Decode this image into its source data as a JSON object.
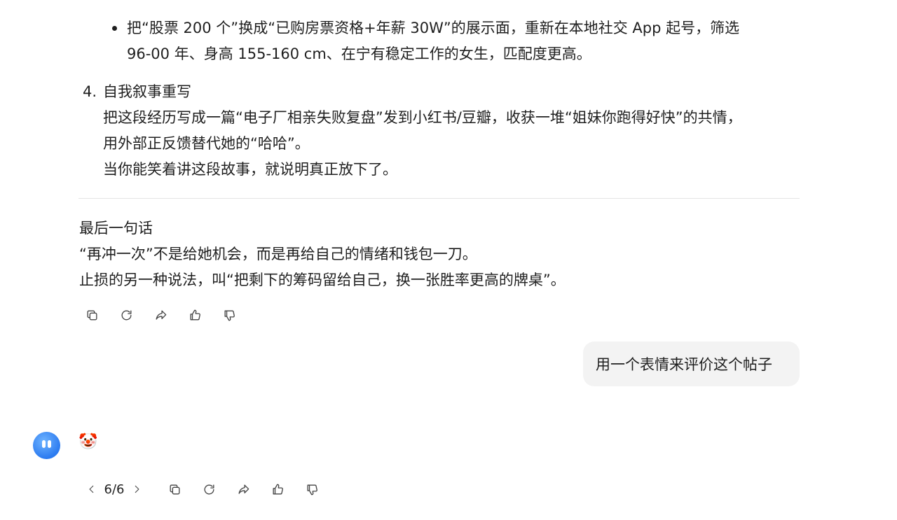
{
  "conversation": {
    "bullet_line1": "把“股票 200 个”换成“已购房票资格+年薪 30W”的展示面，重新在本地社交 App 起号，筛选",
    "bullet_line2": "96-00 年、身高 155-160 cm、在宁有稳定工作的女生，匹配度更高。",
    "item4_number": "4.",
    "item4_title": "自我叙事重写",
    "item4_line1": "把这段经历写成一篇“电子厂相亲失败复盘”发到小红书/豆瓣，收获一堆“姐妹你跑得好快”的共情，",
    "item4_line2": "用外部正反馈替代她的“哈哈”。",
    "item4_line3": "当你能笑着讲这段故事，就说明真正放下了。",
    "closing_title": "最后一句话",
    "closing_line1": "“再冲一次”不是给她机会，而是再给自己的情绪和钱包一刀。",
    "closing_line2": "止损的另一种说法，叫“把剩下的筹码留给自己，换一张胜率更高的牌桌”。"
  },
  "user_message": "用一个表情来评价这个帖子",
  "assistant_reply": "🤡",
  "pager": {
    "current": "6/6"
  },
  "icons": {
    "copy": "copy-icon",
    "regenerate": "refresh-icon",
    "share": "share-icon",
    "like": "thumbs-up-icon",
    "dislike": "thumbs-down-icon",
    "prev": "chevron-left-icon",
    "next": "chevron-right-icon"
  },
  "colors": {
    "text": "#1f1f1f",
    "bubble": "#f3f3f3",
    "avatar": "#2c7bf0",
    "icon": "#444444"
  }
}
